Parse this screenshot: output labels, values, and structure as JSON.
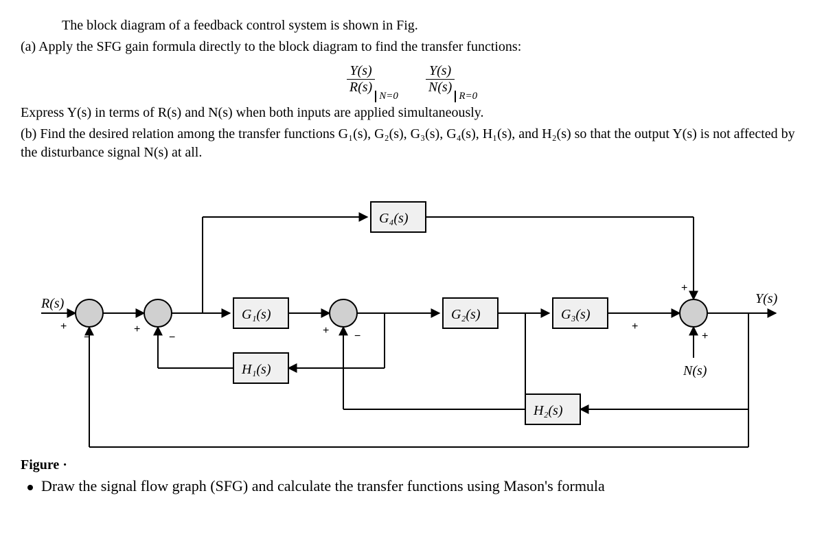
{
  "text": {
    "intro": "The block diagram of a feedback control system is shown in Fig.",
    "a_sentence": "(a)  Apply the SFG gain formula directly to the block diagram to find the transfer functions:",
    "express": "Express Y(s) in terms of R(s) and N(s) when both inputs are applied simultaneously.",
    "b_sentence": "(b)  Find the desired relation among the transfer functions G₁(s), G₂(s), G₃(s), G₄(s), H₁(s), and H₂(s) so that the output Y(s) is not affected by the disturbance signal N(s) at all.",
    "figure": "Figure ·",
    "bullet": "Draw the signal flow graph (SFG) and calculate the transfer functions using Mason's formula"
  },
  "formulas": {
    "tf1_num": "Y(s)",
    "tf1_den": "R(s)",
    "tf1_cond": "N=0",
    "tf2_num": "Y(s)",
    "tf2_den": "N(s)",
    "tf2_cond": "R=0"
  },
  "diagram": {
    "R": "R(s)",
    "Y": "Y(s)",
    "N": "N(s)",
    "G1": "G₁(s)",
    "G2": "G₂(s)",
    "G3": "G₃(s)",
    "G4": "G₄(s)",
    "H1": "H₁(s)",
    "H2": "H₂(s)",
    "plus": "+",
    "minus": "−"
  }
}
